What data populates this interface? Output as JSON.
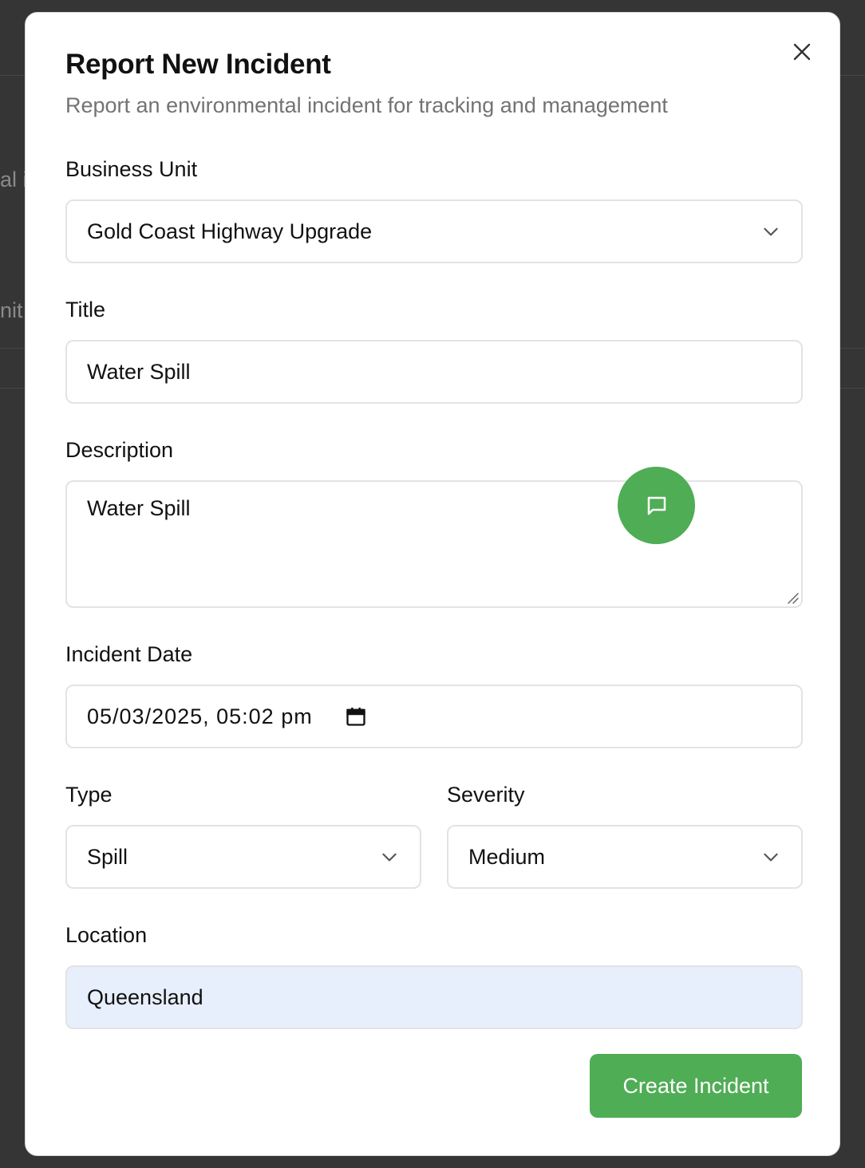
{
  "background": {
    "partial_text_1": "al i",
    "partial_text_2": "nit"
  },
  "modal": {
    "title": "Report New Incident",
    "subtitle": "Report an environmental incident for tracking and management",
    "close_icon": "close-icon"
  },
  "form": {
    "business_unit": {
      "label": "Business Unit",
      "value": "Gold Coast Highway Upgrade"
    },
    "title": {
      "label": "Title",
      "value": "Water Spill"
    },
    "description": {
      "label": "Description",
      "value": "Water Spill"
    },
    "incident_date": {
      "label": "Incident Date",
      "value": "05/03/2025, 05:02 pm",
      "icon": "calendar-icon"
    },
    "type": {
      "label": "Type",
      "value": "Spill"
    },
    "severity": {
      "label": "Severity",
      "value": "Medium"
    },
    "location": {
      "label": "Location",
      "value": "Queensland"
    },
    "submit_label": "Create Incident"
  },
  "chat_fab": {
    "icon": "chat-icon"
  },
  "colors": {
    "accent": "#4fad55",
    "backdrop": "#353535",
    "autofill": "#e8effc"
  }
}
